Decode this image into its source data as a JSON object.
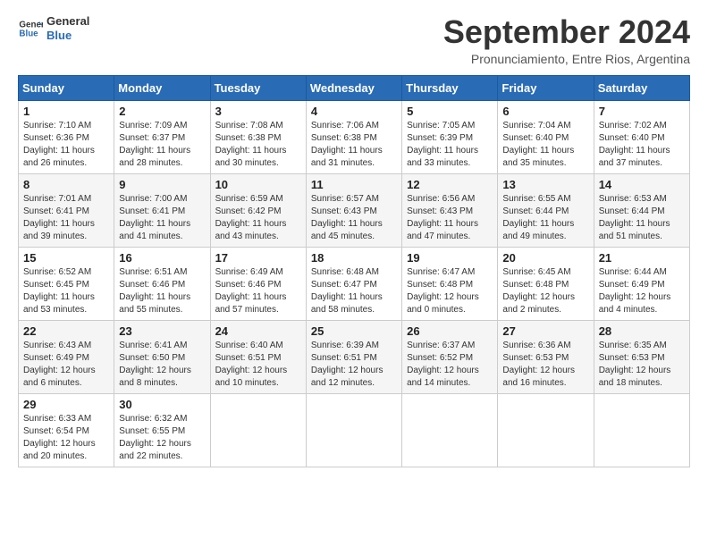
{
  "logo": {
    "line1": "General",
    "line2": "Blue"
  },
  "title": "September 2024",
  "subtitle": "Pronunciamiento, Entre Rios, Argentina",
  "weekdays": [
    "Sunday",
    "Monday",
    "Tuesday",
    "Wednesday",
    "Thursday",
    "Friday",
    "Saturday"
  ],
  "weeks": [
    [
      {
        "day": "1",
        "info": "Sunrise: 7:10 AM\nSunset: 6:36 PM\nDaylight: 11 hours\nand 26 minutes."
      },
      {
        "day": "2",
        "info": "Sunrise: 7:09 AM\nSunset: 6:37 PM\nDaylight: 11 hours\nand 28 minutes."
      },
      {
        "day": "3",
        "info": "Sunrise: 7:08 AM\nSunset: 6:38 PM\nDaylight: 11 hours\nand 30 minutes."
      },
      {
        "day": "4",
        "info": "Sunrise: 7:06 AM\nSunset: 6:38 PM\nDaylight: 11 hours\nand 31 minutes."
      },
      {
        "day": "5",
        "info": "Sunrise: 7:05 AM\nSunset: 6:39 PM\nDaylight: 11 hours\nand 33 minutes."
      },
      {
        "day": "6",
        "info": "Sunrise: 7:04 AM\nSunset: 6:40 PM\nDaylight: 11 hours\nand 35 minutes."
      },
      {
        "day": "7",
        "info": "Sunrise: 7:02 AM\nSunset: 6:40 PM\nDaylight: 11 hours\nand 37 minutes."
      }
    ],
    [
      {
        "day": "8",
        "info": "Sunrise: 7:01 AM\nSunset: 6:41 PM\nDaylight: 11 hours\nand 39 minutes."
      },
      {
        "day": "9",
        "info": "Sunrise: 7:00 AM\nSunset: 6:41 PM\nDaylight: 11 hours\nand 41 minutes."
      },
      {
        "day": "10",
        "info": "Sunrise: 6:59 AM\nSunset: 6:42 PM\nDaylight: 11 hours\nand 43 minutes."
      },
      {
        "day": "11",
        "info": "Sunrise: 6:57 AM\nSunset: 6:43 PM\nDaylight: 11 hours\nand 45 minutes."
      },
      {
        "day": "12",
        "info": "Sunrise: 6:56 AM\nSunset: 6:43 PM\nDaylight: 11 hours\nand 47 minutes."
      },
      {
        "day": "13",
        "info": "Sunrise: 6:55 AM\nSunset: 6:44 PM\nDaylight: 11 hours\nand 49 minutes."
      },
      {
        "day": "14",
        "info": "Sunrise: 6:53 AM\nSunset: 6:44 PM\nDaylight: 11 hours\nand 51 minutes."
      }
    ],
    [
      {
        "day": "15",
        "info": "Sunrise: 6:52 AM\nSunset: 6:45 PM\nDaylight: 11 hours\nand 53 minutes."
      },
      {
        "day": "16",
        "info": "Sunrise: 6:51 AM\nSunset: 6:46 PM\nDaylight: 11 hours\nand 55 minutes."
      },
      {
        "day": "17",
        "info": "Sunrise: 6:49 AM\nSunset: 6:46 PM\nDaylight: 11 hours\nand 57 minutes."
      },
      {
        "day": "18",
        "info": "Sunrise: 6:48 AM\nSunset: 6:47 PM\nDaylight: 11 hours\nand 58 minutes."
      },
      {
        "day": "19",
        "info": "Sunrise: 6:47 AM\nSunset: 6:48 PM\nDaylight: 12 hours\nand 0 minutes."
      },
      {
        "day": "20",
        "info": "Sunrise: 6:45 AM\nSunset: 6:48 PM\nDaylight: 12 hours\nand 2 minutes."
      },
      {
        "day": "21",
        "info": "Sunrise: 6:44 AM\nSunset: 6:49 PM\nDaylight: 12 hours\nand 4 minutes."
      }
    ],
    [
      {
        "day": "22",
        "info": "Sunrise: 6:43 AM\nSunset: 6:49 PM\nDaylight: 12 hours\nand 6 minutes."
      },
      {
        "day": "23",
        "info": "Sunrise: 6:41 AM\nSunset: 6:50 PM\nDaylight: 12 hours\nand 8 minutes."
      },
      {
        "day": "24",
        "info": "Sunrise: 6:40 AM\nSunset: 6:51 PM\nDaylight: 12 hours\nand 10 minutes."
      },
      {
        "day": "25",
        "info": "Sunrise: 6:39 AM\nSunset: 6:51 PM\nDaylight: 12 hours\nand 12 minutes."
      },
      {
        "day": "26",
        "info": "Sunrise: 6:37 AM\nSunset: 6:52 PM\nDaylight: 12 hours\nand 14 minutes."
      },
      {
        "day": "27",
        "info": "Sunrise: 6:36 AM\nSunset: 6:53 PM\nDaylight: 12 hours\nand 16 minutes."
      },
      {
        "day": "28",
        "info": "Sunrise: 6:35 AM\nSunset: 6:53 PM\nDaylight: 12 hours\nand 18 minutes."
      }
    ],
    [
      {
        "day": "29",
        "info": "Sunrise: 6:33 AM\nSunset: 6:54 PM\nDaylight: 12 hours\nand 20 minutes."
      },
      {
        "day": "30",
        "info": "Sunrise: 6:32 AM\nSunset: 6:55 PM\nDaylight: 12 hours\nand 22 minutes."
      },
      {
        "day": "",
        "info": ""
      },
      {
        "day": "",
        "info": ""
      },
      {
        "day": "",
        "info": ""
      },
      {
        "day": "",
        "info": ""
      },
      {
        "day": "",
        "info": ""
      }
    ]
  ]
}
